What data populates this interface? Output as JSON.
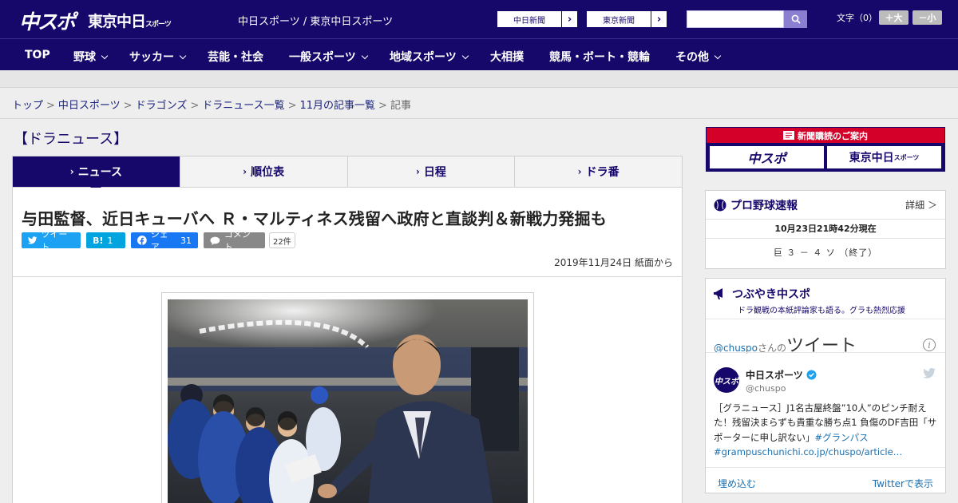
{
  "header": {
    "logo_chuspo": "中スポ",
    "logo_tokyo": "東京中日",
    "logo_tokyo_small": "スポーツ",
    "site_subtitle": "中日スポーツ / 東京中日スポーツ",
    "paper_link_1": "中日新聞",
    "paper_link_2": "東京新聞",
    "search_value": "",
    "font_size_label": "文字（0）",
    "font_increase": "＋大",
    "font_decrease": "－小"
  },
  "nav": {
    "items": [
      {
        "label": "TOP"
      },
      {
        "label": "野球"
      },
      {
        "label": "サッカー"
      },
      {
        "label": "芸能・社会"
      },
      {
        "label": "一般スポーツ"
      },
      {
        "label": "地域スポーツ"
      },
      {
        "label": "大相撲"
      },
      {
        "label": "競馬・ボート・競輪"
      },
      {
        "label": "その他"
      }
    ]
  },
  "breadcrumb": {
    "items": [
      "トップ",
      "中日スポーツ",
      "ドラゴンズ",
      "ドラニュース一覧",
      "11月の記事一覧"
    ],
    "current": "記事"
  },
  "section_title": "【ドラニュース】",
  "tabs": [
    {
      "label": "ニュース"
    },
    {
      "label": "順位表"
    },
    {
      "label": "日程"
    },
    {
      "label": "ドラ番"
    }
  ],
  "article": {
    "headline": "与田監督、近日キューバへ Ｒ・マルティネス残留へ政府と直談判＆新戦力発掘も",
    "share_tweet": "ツイート",
    "share_hatena_count": "1",
    "share_facebook": "シェア",
    "share_facebook_count": "31",
    "share_comment": "コメント",
    "comment_count": "22件",
    "dateline": "2019年11月24日 紙面から"
  },
  "sidebar": {
    "subscription_banner": "新聞購読のご案内",
    "sub_logo_1": "中スポ",
    "sub_logo_2": "東京中日",
    "sub_logo_2_small": "スポーツ",
    "baseball": {
      "title": "プロ野球速報",
      "detail": "詳細 ＞",
      "timestamp": "10月23日21時42分現在",
      "score": "巨 ３ － ４ ソ （終了）"
    },
    "tweets": {
      "title": "つぶやき中スポ",
      "subtitle": "ドラ観戦の本紙評論家も語る。グラも熱烈応援",
      "handle_link": "@chuspo",
      "san": "さんの",
      "tweet_word": "ツイート",
      "account_name": "中日スポーツ",
      "account_handle": "@chuspo",
      "avatar_text": "中スポ",
      "tweet_text": "［グラニュース］J1名古屋終盤”10人”のピンチ耐えた！残留決まらずも貴重な勝ち点1 負傷のDF吉田「サポーターに申し訳ない」",
      "hashtag": "#グランパス",
      "link": "#grampuschunichi.co.jp/chuspo/article…",
      "embed": "埋め込む",
      "view_on_twitter": "Twitterで表示"
    }
  },
  "colors": {
    "brand_navy": "#16086b",
    "twitter": "#1da1f2",
    "hatena": "#00a4de",
    "facebook": "#1877f2",
    "comment": "#888888",
    "subscription_red": "#d4002a"
  }
}
